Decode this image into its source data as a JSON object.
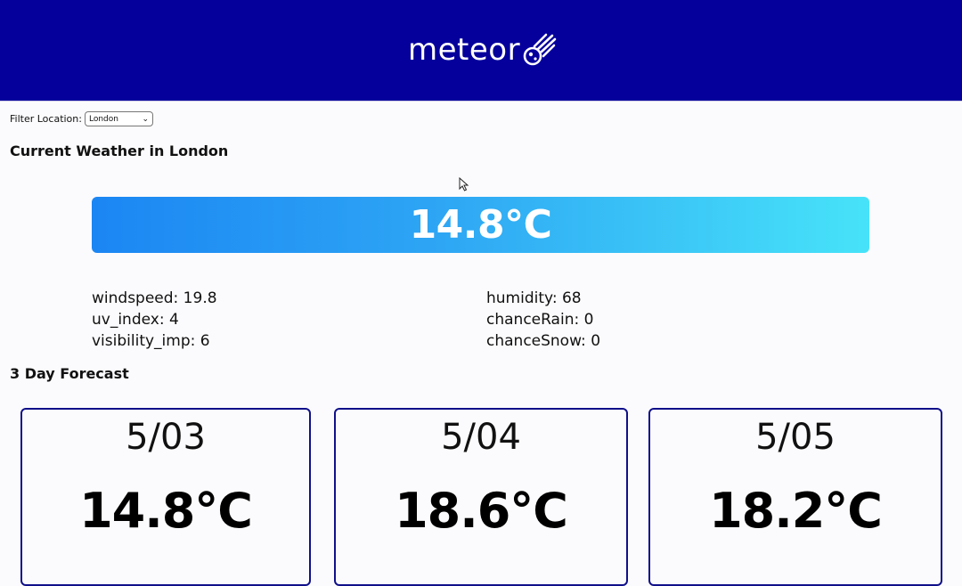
{
  "app": {
    "logo_text": "meteor"
  },
  "filter": {
    "label": "Filter Location:",
    "selected": "London"
  },
  "current": {
    "title": "Current Weather in London",
    "temperature": "14.8°C",
    "stats": {
      "windspeed": "windspeed: 19.8",
      "uv_index": "uv_index: 4",
      "visibility_imp": "visibility_imp: 6",
      "humidity": "humidity: 68",
      "chanceRain": "chanceRain: 0",
      "chanceSnow": "chanceSnow: 0"
    }
  },
  "forecast": {
    "title": "3 Day Forecast",
    "days": [
      {
        "date": "5/03",
        "temperature": "14.8°C"
      },
      {
        "date": "5/04",
        "temperature": "18.6°C"
      },
      {
        "date": "5/05",
        "temperature": "18.2°C"
      }
    ]
  },
  "colors": {
    "header_bg": "#05009c",
    "card_border": "#10108a",
    "gradient_start": "#1b86f3",
    "gradient_end": "#47e3f9"
  },
  "icons": {
    "logo": "meteor-icon",
    "select_arrow": "chevron-down-icon",
    "cursor": "mouse-pointer-icon"
  }
}
